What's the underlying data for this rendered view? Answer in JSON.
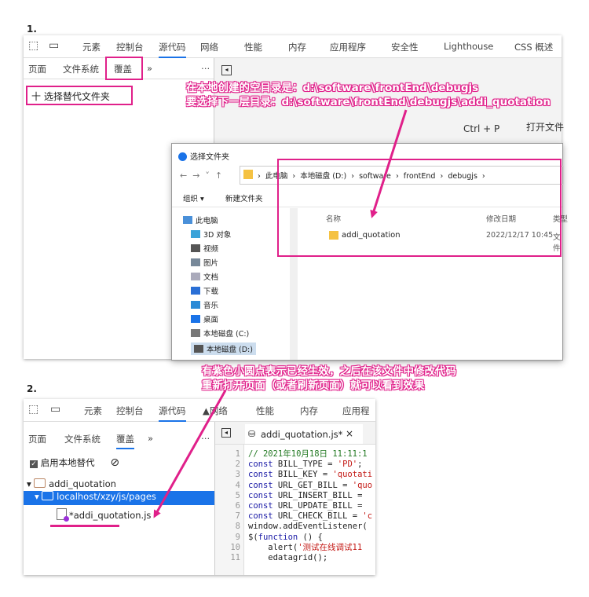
{
  "step1": {
    "number": "1.",
    "tabs": [
      "元素",
      "控制台",
      "源代码",
      "网络",
      "性能",
      "内存",
      "应用程序",
      "安全性",
      "Lighthouse",
      "CSS 概述"
    ],
    "subtabs": [
      "页面",
      "文件系统",
      "覆盖",
      "»",
      "⋯"
    ],
    "select_folder_button": "十 选择替代文件夹",
    "shortcut_label": "Ctrl + P",
    "open_file_label": "打开文件",
    "annotation_line1": "在本地创建的空目录是：d:\\software\\frontEnd\\debugjs",
    "annotation_line2": "要选择下一层目录：d:\\software\\frontEnd\\debugjs\\addi_quotation",
    "dialog": {
      "title": "选择文件夹",
      "breadcrumb": [
        "此电脑",
        "本地磁盘 (D:)",
        "software",
        "frontEnd",
        "debugjs"
      ],
      "organize": "组织 ▾",
      "new_folder": "新建文件夹",
      "sidebar": [
        "此电脑",
        "3D 对象",
        "视频",
        "图片",
        "文档",
        "下载",
        "音乐",
        "桌面",
        "本地磁盘 (C:)",
        "本地磁盘 (D:)"
      ],
      "col_name": "名称",
      "col_date": "修改日期",
      "col_type": "类型",
      "folder_name": "addi_quotation",
      "folder_date": "2022/12/17 10:45",
      "folder_type": "文件"
    }
  },
  "middle_annotation_line1": "有紫色小圆点表示已经生效，之后在该文件中修改代码",
  "middle_annotation_line2": "重新打开页面（或者刷新页面）就可以看到效果",
  "step2": {
    "number": "2.",
    "tabs": [
      "元素",
      "控制台",
      "源代码",
      "▲网络",
      "性能",
      "内存",
      "应用程"
    ],
    "subtabs": [
      "页面",
      "文件系统",
      "覆盖",
      "»",
      "⋯"
    ],
    "enable_override": "启用本地替代",
    "tree": [
      "addi_quotation",
      "localhost/xzy/js/pages",
      "*addi_quotation.js"
    ],
    "editor_tab": "addi_quotation.js*",
    "close": "×",
    "line_numbers": [
      "1",
      "2",
      "3",
      "4",
      "5",
      "6",
      "7",
      "8",
      "9",
      "10",
      "11"
    ],
    "code_lines": [
      "// 2021年10月18日 11:11:1",
      "const BILL_TYPE = 'PD';",
      "const BILL_KEY = 'quotati",
      "const URL_GET_BILL = 'quo",
      "const URL_INSERT_BILL = ",
      "const URL_UPDATE_BILL = ",
      "const URL_CHECK_BILL = 'c",
      "window.addEventListener(",
      "$(function () {",
      "    alert('测试在线调试11",
      "    edatagrid();"
    ]
  },
  "colors": {
    "accent_pink": "#e0208a",
    "selected_blue": "#1a73e8",
    "code_green": "#237a23",
    "code_blue": "#1a1aa6",
    "code_red": "#c41a16"
  }
}
